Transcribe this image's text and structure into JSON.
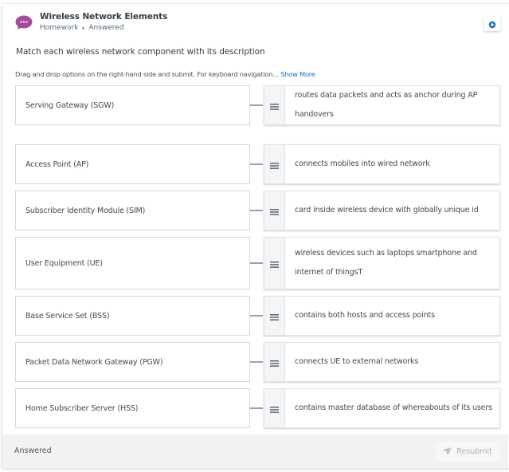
{
  "header": {
    "icon": "chat-bubble-icon",
    "title": "Wireless Network Elements",
    "category": "Homework",
    "status": "Answered",
    "corner_icon": "record-icon",
    "accent_color": "#a54c9a",
    "corner_icon_color": "#1a6bc4"
  },
  "question": {
    "prompt": "Match each wireless network component with its description",
    "instructions": "Drag and drop options on the right-hand side and submit. For keyboard navigation...",
    "show_more_label": "Show More"
  },
  "pairs": [
    {
      "term": "Serving Gateway (SGW)",
      "description": "routes data packets and acts as anchor during AP handovers"
    },
    {
      "term": "Access Point (AP)",
      "description": "connects mobiles into wired network"
    },
    {
      "term": "Subscriber Identity Module (SIM)",
      "description": "card inside wireless device with globally unique id"
    },
    {
      "term": "User Equipment (UE)",
      "description": "wireless devices such as laptops smartphone and internet of thingsT"
    },
    {
      "term": "Base Service Set (BSS)",
      "description": "contains both hosts and access points"
    },
    {
      "term": "Packet Data Network Gateway (PGW)",
      "description": "connects UE to external networks"
    },
    {
      "term": "Home Subscriber Server (HSS)",
      "description": "contains master database of whereabouts of its users"
    }
  ],
  "footer": {
    "status": "Answered",
    "resubmit_label": "Resubmit",
    "resubmit_icon": "send-icon"
  }
}
